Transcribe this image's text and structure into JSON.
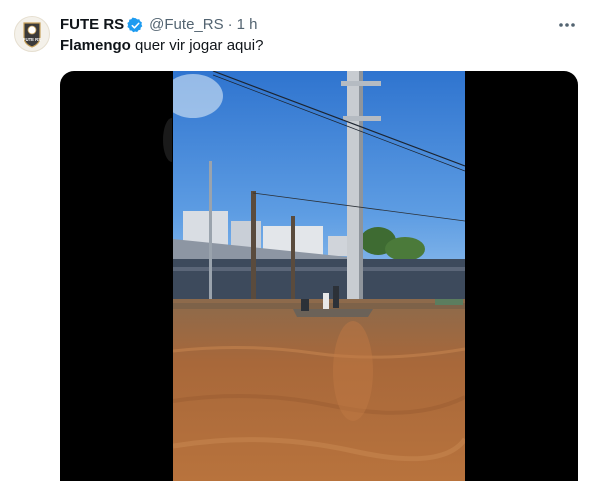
{
  "account": {
    "display_name": "FUTE RS",
    "handle": "@Fute_RS",
    "separator": "·",
    "time": "1 h",
    "avatar_text": "FUTE RS"
  },
  "tweet": {
    "text_bold": "Flamengo",
    "text_rest": " quer vir jogar aqui?"
  },
  "icons": {
    "verified": "verified-badge-icon",
    "more": "more-options-icon"
  },
  "colors": {
    "verified_blue": "#1d9bf0",
    "secondary_text": "#536471",
    "floodwater": "#a8683a",
    "sky": "#3f86d8"
  }
}
